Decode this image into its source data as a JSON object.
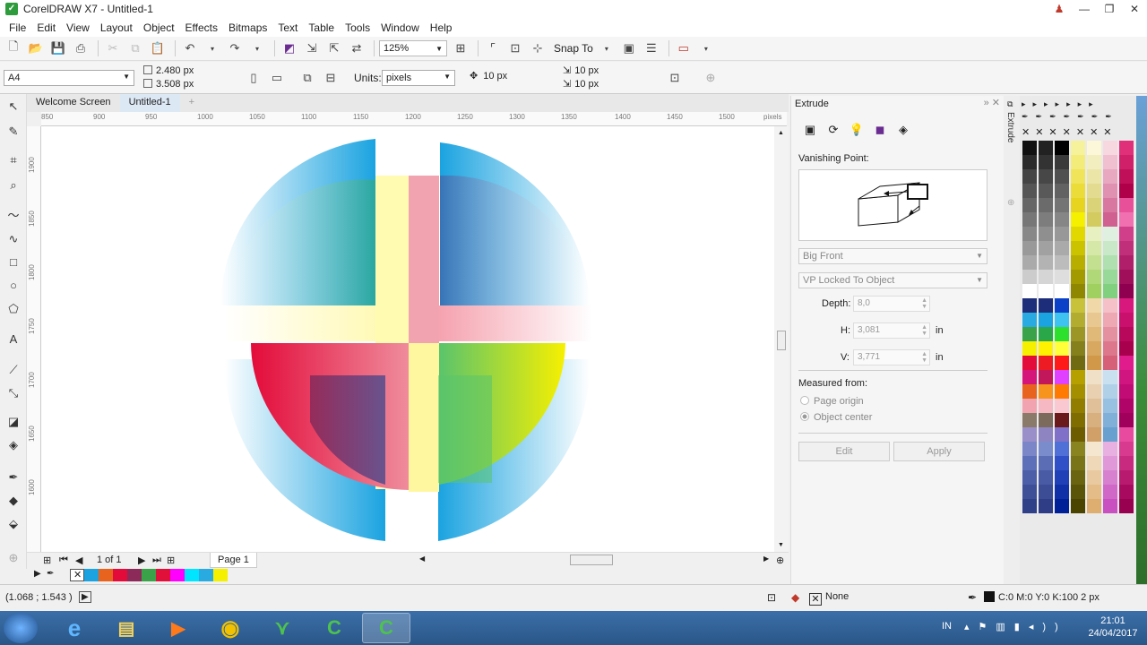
{
  "window": {
    "title": "CorelDRAW X7 - Untitled-1"
  },
  "menu": [
    "File",
    "Edit",
    "View",
    "Layout",
    "Object",
    "Effects",
    "Bitmaps",
    "Text",
    "Table",
    "Tools",
    "Window",
    "Help"
  ],
  "toolbar": {
    "zoom": "125%",
    "snap_to": "Snap To"
  },
  "property_bar": {
    "page_size": "A4",
    "width": "2.480 px",
    "height": "3.508 px",
    "units_label": "Units:",
    "units": "pixels",
    "nudge": "10 px",
    "dup_x": "10 px",
    "dup_y": "10 px"
  },
  "doc_tabs": [
    "Welcome Screen",
    "Untitled-1"
  ],
  "ruler": {
    "h_ticks": [
      "850",
      "900",
      "950",
      "1000",
      "1050",
      "1100",
      "1150",
      "1200",
      "1250",
      "1300",
      "1350",
      "1400",
      "1450",
      "1500"
    ],
    "h_unit": "pixels",
    "v_ticks": [
      "1900",
      "1850",
      "1800",
      "1750",
      "1700",
      "1650",
      "1600"
    ]
  },
  "page_nav": {
    "position": "1 of 1",
    "page_tab": "Page 1"
  },
  "docker": {
    "title": "Extrude",
    "vanishing_point_label": "Vanishing Point:",
    "extrusion_type": "Big Front",
    "vp_lock": "VP Locked To Object",
    "depth_label": "Depth:",
    "depth": "8,0",
    "h_label": "H:",
    "h": "3,081",
    "h_unit": "in",
    "v_label": "V:",
    "v": "3,771",
    "v_unit": "in",
    "measured_from_label": "Measured from:",
    "opt_page_origin": "Page origin",
    "opt_object_center": "Object center",
    "edit_label": "Edit",
    "apply_label": "Apply",
    "side_tab": "Extrude"
  },
  "status": {
    "coordinates": "(1.068 ; 1.543 )",
    "fill": "None",
    "outline": "C:0 M:0 Y:0 K:100  2 px"
  },
  "taskbar": {
    "lang": "IN",
    "time": "21:01",
    "date": "24/04/2017"
  },
  "colors": {
    "accent_blue": "#29abe2",
    "red": "#e30b3a",
    "yellow": "#f5ef00",
    "pink": "#f08aa0",
    "green": "#5cc36b"
  }
}
